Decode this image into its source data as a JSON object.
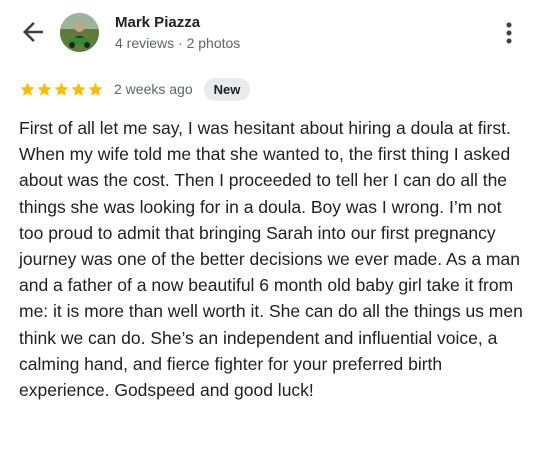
{
  "reviewer": {
    "name": "Mark Piazza",
    "meta": "4 reviews · 2 photos"
  },
  "review": {
    "rating": 5,
    "max_rating": 5,
    "time": "2 weeks ago",
    "badge": "New",
    "text": "First of all let me say, I was hesitant about hiring a doula at first. When my wife told me that she wanted to, the first thing I asked about was the cost. Then I proceeded to tell her I can do all the things she was looking for in a doula. Boy was I wrong. I’m not too proud to admit that bringing Sarah into our first pregnancy journey was one of the better decisions we ever made. As a man and a father of a now beautiful 6 month old baby girl take it from me: it is more than well worth it. She can do all the things us men think we can do. She’s an independent and influential voice, a calming hand, and fierce fighter for your preferred birth experience. Godspeed and good luck!"
  },
  "icons": {
    "back": "arrow-back-icon",
    "more": "more-vert-icon",
    "star": "star-icon"
  },
  "colors": {
    "star": "#fbbc04",
    "text": "#202124",
    "secondary_text": "#5f6368",
    "badge_bg": "#e8eaed"
  }
}
